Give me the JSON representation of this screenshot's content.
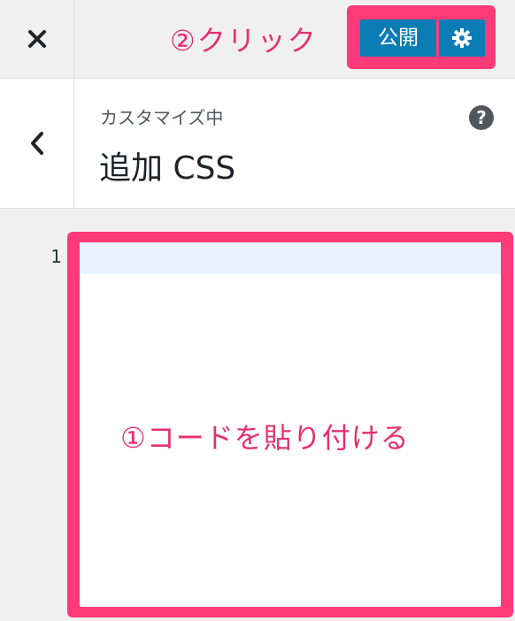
{
  "header": {
    "close_label": "×",
    "publish_label": "公開",
    "annotation_click": "②クリック",
    "icons": {
      "close": "close-icon",
      "settings": "gear-icon"
    }
  },
  "section": {
    "subtitle": "カスタマイズ中",
    "title": "追加 CSS",
    "help_label": "?",
    "icons": {
      "back": "chevron-left-icon",
      "help": "help-icon"
    }
  },
  "editor": {
    "line_numbers": [
      "1"
    ],
    "annotation_paste": "①コードを貼り付ける"
  },
  "colors": {
    "accent_pink": "#ff3a78",
    "annotation_text": "#e5306f",
    "publish_blue": "#0a7db4",
    "active_line": "#e8f2fe"
  }
}
